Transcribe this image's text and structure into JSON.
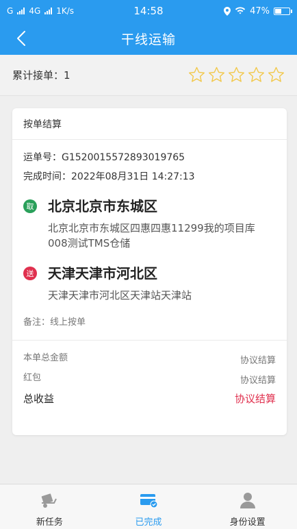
{
  "status_bar": {
    "left": "G",
    "network": "4G",
    "speed": "1K/s",
    "time": "14:58",
    "battery": "47%",
    "battery_level": 0.47
  },
  "nav": {
    "title": "干线运输"
  },
  "summary": {
    "label": "累计接单：1",
    "stars_filled": 0,
    "stars_total": 5
  },
  "card": {
    "header": "按单结算",
    "order_no": "运单号：G1520015572893019765",
    "completed_time": "完成时间：2022年08月31日 14:27:13",
    "pickup": {
      "badge": "取",
      "city": "北京北京市东城区",
      "address": "北京北京市东城区四惠四惠11299我的项目库008测试TMS仓储"
    },
    "delivery": {
      "badge": "送",
      "city": "天津天津市河北区",
      "address": "天津天津市河北区天津站天津站"
    },
    "remark": "备注：线上按单",
    "total_amount_label": "本单总金额",
    "total_amount_value": "协议结算",
    "red_packet_label": "红包",
    "red_packet_value": "协议结算",
    "income_label": "总收益",
    "income_value": "协议结算"
  },
  "tabs": [
    {
      "label": "新任务"
    },
    {
      "label": "已完成"
    },
    {
      "label": "身份设置"
    }
  ],
  "colors": {
    "primary": "#2a9bef",
    "pickup_badge": "#2aa05a",
    "delivery_badge": "#e0304e",
    "star": "#f2c84b",
    "income": "#e0304e"
  }
}
